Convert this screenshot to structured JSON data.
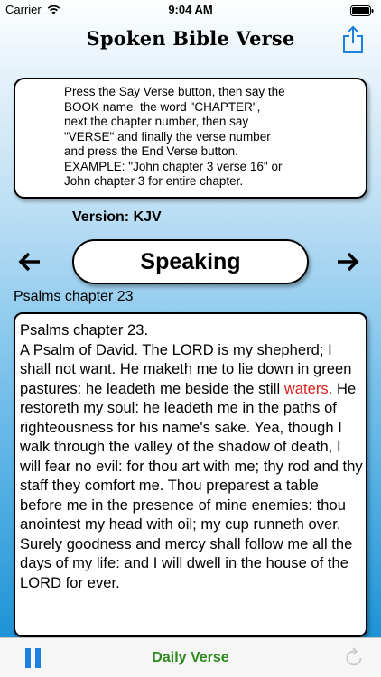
{
  "status_bar": {
    "carrier": "Carrier",
    "time": "9:04 AM",
    "icons": [
      "wifi-icon",
      "battery-icon"
    ]
  },
  "header": {
    "title": "Spoken Bible Verse",
    "share_icon": "share-icon"
  },
  "instructions": "Press the Say Verse button, then say the\nBOOK name, the word \"CHAPTER\",\nnext the chapter number, then say\n\"VERSE\" and finally the verse number\nand press the End Verse button.\nEXAMPLE: \"John chapter 3 verse 16\" or\nJohn chapter 3 for entire chapter.",
  "version_label": "Version: KJV",
  "controls": {
    "prev_icon": "arrow-left-icon",
    "next_icon": "arrow-right-icon",
    "speak_label": "Speaking"
  },
  "passage_label": "Psalms chapter 23",
  "verse": {
    "before": "Psalms chapter 23.\nA Psalm of David.  The LORD is my shepherd; I shall not want. He maketh me to lie down in green pastures: he leadeth me beside the still ",
    "highlight": "waters.",
    "after": " He restoreth my soul: he leadeth me in the paths of righteousness for his name's sake. Yea, though I walk through the valley of the shadow of death, I will fear no evil: for thou art with me; thy rod and thy staff they comfort me. Thou preparest a table before me in the presence of mine enemies: thou anointest my head with oil; my cup runneth over. Surely goodness and mercy shall follow me all the days of my life: and I will dwell in the house of the LORD for ever.",
    "highlight_color": "#d81e1e"
  },
  "toolbar": {
    "pause_icon": "pause-icon",
    "daily_verse_label": "Daily Verse",
    "daily_verse_color": "#2d8a1c",
    "refresh_icon": "refresh-icon"
  }
}
